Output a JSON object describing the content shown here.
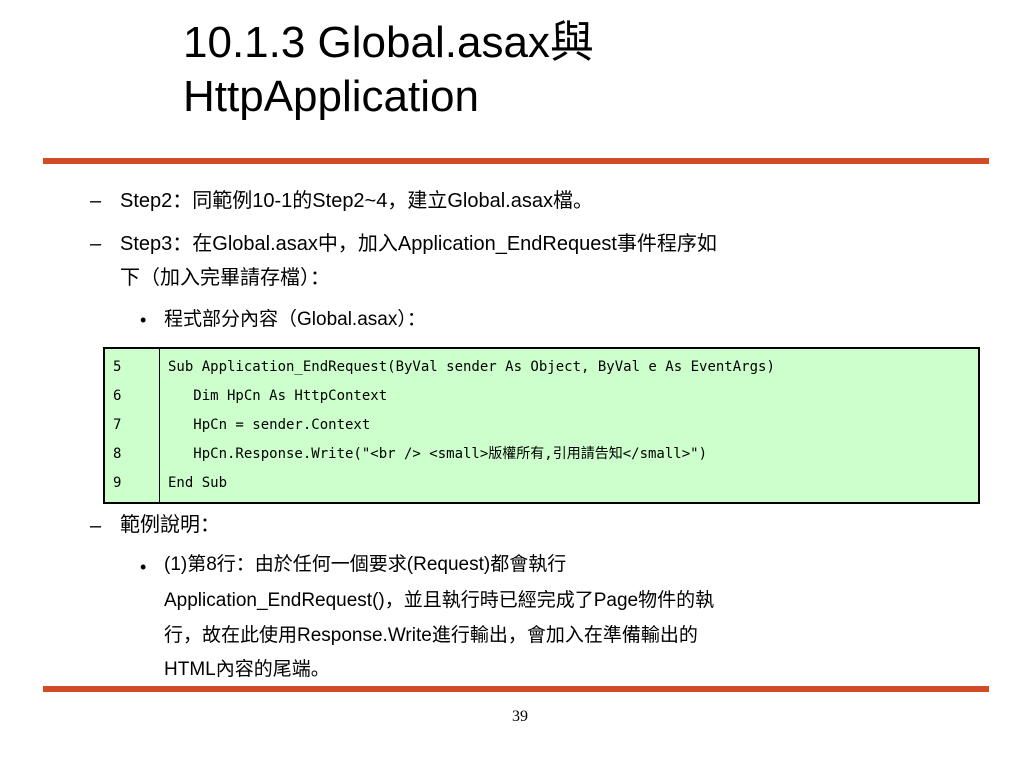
{
  "slide": {
    "title_line1": "10.1.3   Global.asax與",
    "title_line2": "HttpApplication",
    "dash_symbol": "–",
    "bullet_symbol": "•",
    "items": {
      "step2": "Step2：同範例10-1的Step2~4，建立Global.asax檔。",
      "step3_line1": "Step3：在Global.asax中，加入Application_EndRequest事件程序如",
      "step3_line2": "下（加入完畢請存檔）：",
      "program_part": "程式部分內容（Global.asax）：",
      "example_heading": "範例說明：",
      "explain_line1": "(1)第8行：由於任何一個要求(Request)都會執行",
      "explain_line2": "Application_EndRequest()，並且執行時已經完成了Page物件的執",
      "explain_line3": "行，故在此使用Response.Write進行輸出，會加入在準備輸出的",
      "explain_line4": "HTML內容的尾端。"
    },
    "code": {
      "line_numbers": [
        "5",
        "6",
        "7",
        "8",
        "9"
      ],
      "lines": [
        "Sub Application_EndRequest(ByVal sender As Object, ByVal e As EventArgs)",
        "   Dim HpCn As HttpContext",
        "   HpCn = sender.Context",
        "   HpCn.Response.Write(\"<br /> <small>版權所有,引用請告知</small>\")",
        "End Sub"
      ]
    },
    "page_number": "39",
    "colors": {
      "rule": "#d24a26",
      "code_background": "#ccffcc"
    }
  }
}
